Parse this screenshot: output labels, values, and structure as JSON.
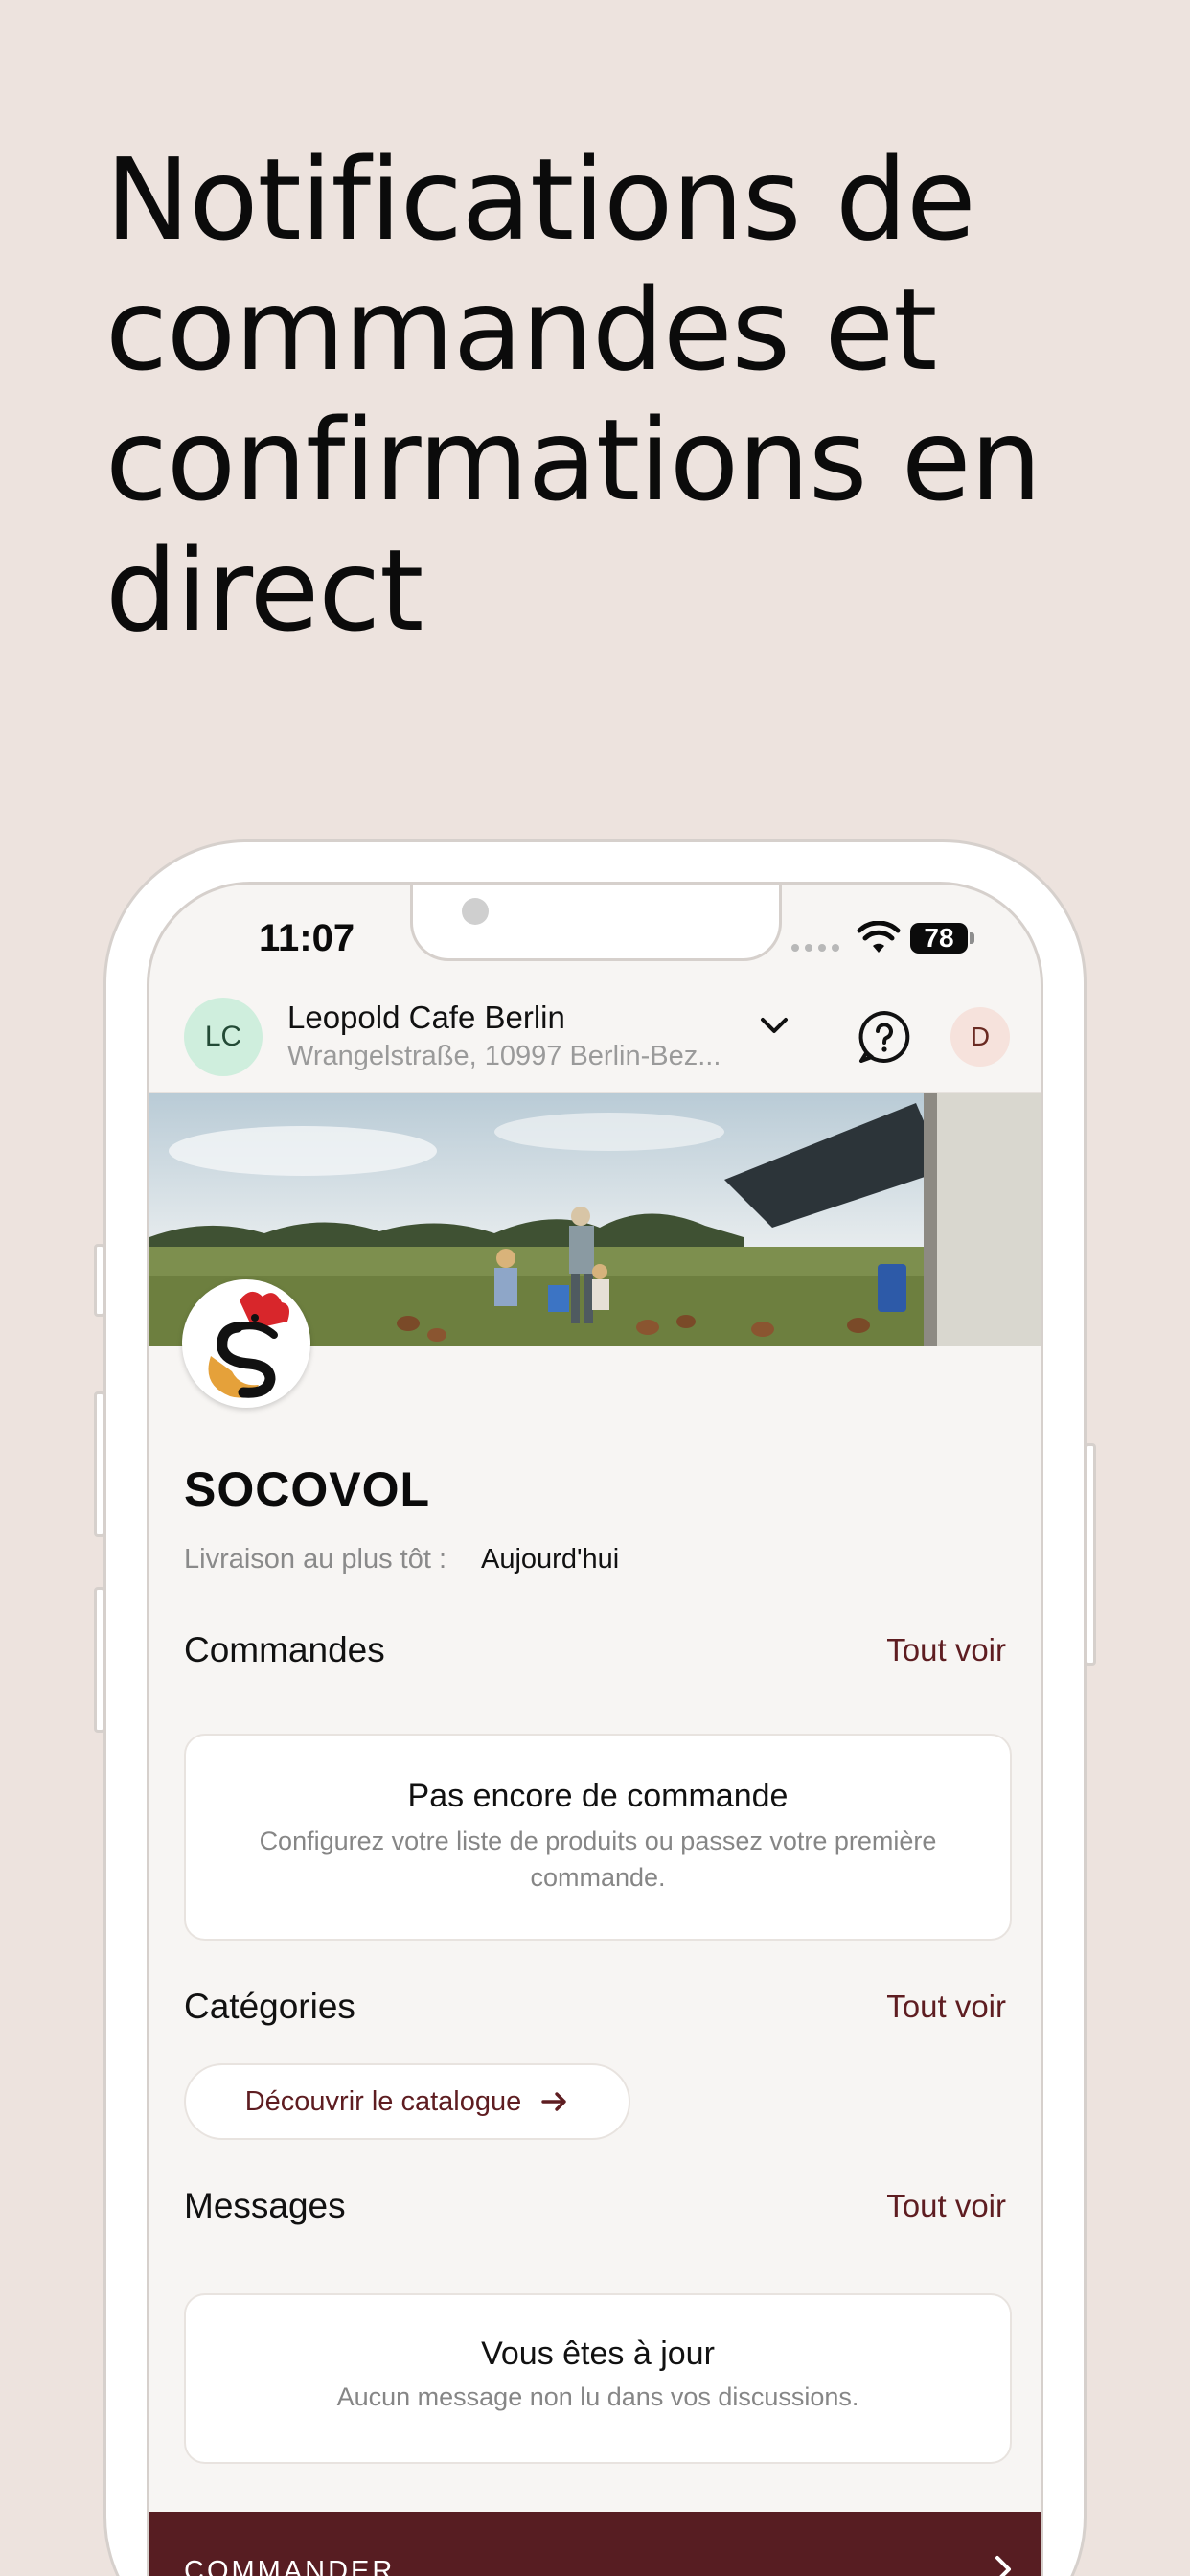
{
  "headline": "Notifications de commandes et confirmations en direct",
  "status_bar": {
    "time": "11:07",
    "battery": "78"
  },
  "header": {
    "avatar_initials": "LC",
    "shop_name": "Leopold Cafe Berlin",
    "shop_address": "Wrangelstraße, 10997 Berlin-Bez...",
    "user_initial": "D"
  },
  "supplier": {
    "name": "SOCOVOL",
    "delivery_label": "Livraison au plus tôt :",
    "delivery_value": "Aujourd'hui"
  },
  "orders": {
    "title": "Commandes",
    "see_all": "Tout voir",
    "empty_title": "Pas encore de commande",
    "empty_text": "Configurez votre liste de produits ou passez votre première commande."
  },
  "categories": {
    "title": "Catégories",
    "see_all": "Tout voir",
    "catalog_button": "Découvrir le catalogue"
  },
  "messages": {
    "title": "Messages",
    "see_all": "Tout voir",
    "empty_title": "Vous êtes à jour",
    "empty_text": "Aucun message non lu dans vos discussions."
  },
  "order_bar": {
    "label": "COMMANDER"
  },
  "colors": {
    "background": "#ede3de",
    "accent": "#5e1d21",
    "order_bar": "#571d22",
    "lc_avatar": "#cfeedd",
    "d_avatar": "#f6e2dc"
  },
  "icons": [
    "wifi-icon",
    "chevron-down-icon",
    "help-icon",
    "arrow-right-icon",
    "chevron-right-icon"
  ]
}
